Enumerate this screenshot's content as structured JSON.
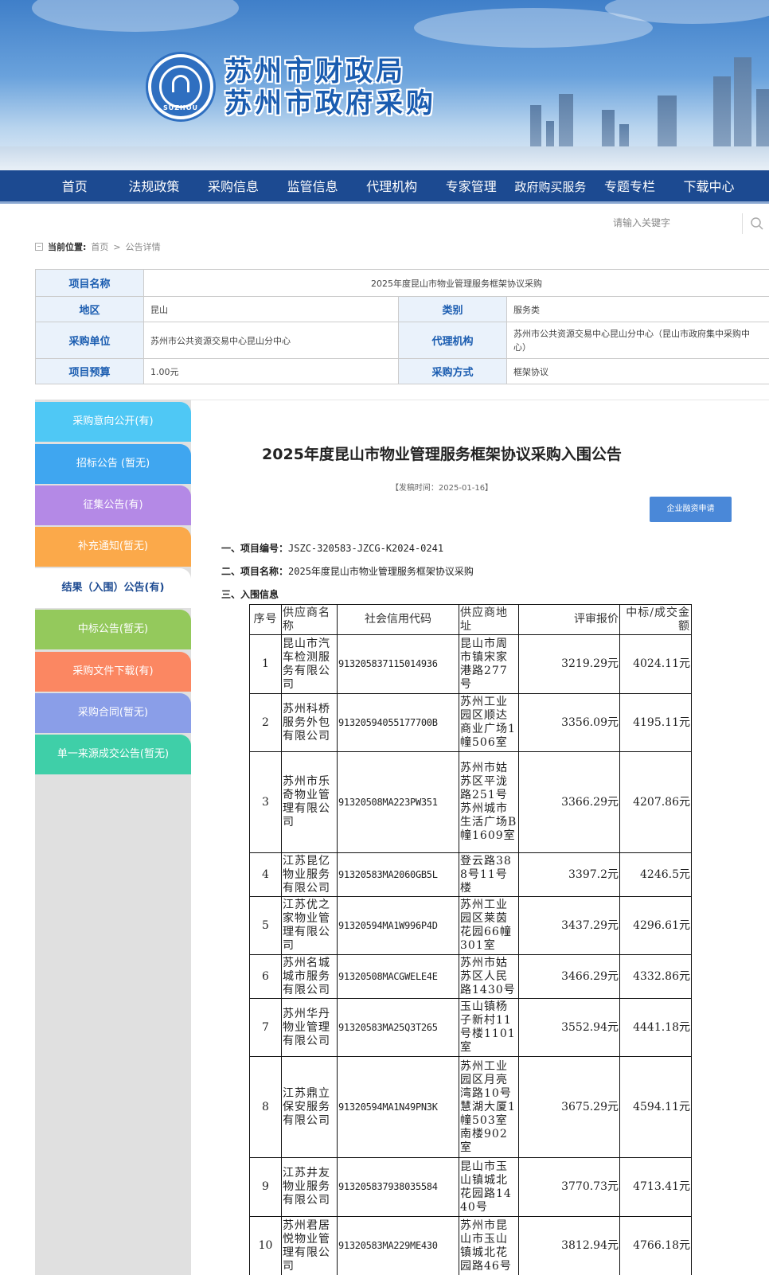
{
  "header": {
    "title_line1": "苏州市财政局",
    "title_line2": "苏州市政府采购",
    "seal_text": "SUZHOU"
  },
  "nav": [
    "首页",
    "法规政策",
    "采购信息",
    "监管信息",
    "代理机构",
    "专家管理",
    "政府购买服务",
    "专题专栏",
    "下载中心"
  ],
  "search": {
    "placeholder": "请输入关键字"
  },
  "breadcrumb": {
    "label": "当前位置:",
    "home": "首页",
    "sep": ">",
    "current": "公告详情"
  },
  "info": {
    "project_name_label": "项目名称",
    "project_name": "2025年度昆山市物业管理服务框架协议采购",
    "region_label": "地区",
    "region": "昆山",
    "category_label": "类别",
    "category": "服务类",
    "buyer_label": "采购单位",
    "buyer": "苏州市公共资源交易中心昆山分中心",
    "agency_label": "代理机构",
    "agency": "苏州市公共资源交易中心昆山分中心（昆山市政府集中采购中心）",
    "budget_label": "项目预算",
    "budget": "1.00元",
    "method_label": "采购方式",
    "method": "框架协议"
  },
  "sidebar": [
    {
      "label": "采购意向公开(有)",
      "color": "#4fc8f5"
    },
    {
      "label": "招标公告 (暂无)",
      "color": "#3fa6f0"
    },
    {
      "label": "征集公告(有)",
      "color": "#b489e6"
    },
    {
      "label": "补充通知(暂无)",
      "color": "#fba94a"
    },
    {
      "label": "结果（入围）公告(有)",
      "color": "#ffffff"
    },
    {
      "label": "中标公告(暂无)",
      "color": "#94c95c"
    },
    {
      "label": "采购文件下载(有)",
      "color": "#fb8762"
    },
    {
      "label": "采购合同(暂无)",
      "color": "#8a9ee8"
    },
    {
      "label": "单一来源成交公告(暂无)",
      "color": "#3fcfa8"
    }
  ],
  "notice": {
    "title": "2025年度昆山市物业管理服务框架协议采购入围公告",
    "pub_time": "【发稿时间：2025-01-16】",
    "finance_button": "企业融资申请",
    "sec1_label": "一、项目编号：",
    "sec1_value": "JSZC-320583-JZCG-K2024-0241",
    "sec2_label": "二、项目名称：",
    "sec2_value": "2025年度昆山市物业管理服务框架协议采购",
    "sec3_label": "三、入围信息"
  },
  "results": {
    "headers": [
      "序号",
      "供应商名称",
      "社会信用代码",
      "供应商地址",
      "评审报价",
      "中标/成交金额"
    ],
    "rows": [
      [
        "1",
        "昆山市汽车检测服务有限公司",
        "913205837115014936",
        "昆山市周市镇宋家港路277号",
        "3219.29元",
        "4024.11元"
      ],
      [
        "2",
        "苏州科桥服务外包有限公司",
        "91320594055177700B",
        "苏州工业园区顺达商业广场1幢506室",
        "3356.09元",
        "4195.11元"
      ],
      [
        "3",
        "苏州市乐奇物业管理有限公司",
        "91320508MA223PW351",
        "苏州市姑苏区平泷路251号苏州城市生活广场B幢1609室",
        "3366.29元",
        "4207.86元"
      ],
      [
        "4",
        "江苏昆亿物业服务有限公司",
        "91320583MA2060GB5L",
        "登云路388号11号楼",
        "3397.2元",
        "4246.5元"
      ],
      [
        "5",
        "江苏优之家物业管理有限公司",
        "91320594MA1W996P4D",
        "苏州工业园区莱茵花园66幢301室",
        "3437.29元",
        "4296.61元"
      ],
      [
        "6",
        "苏州名城城市服务有限公司",
        "91320508MACGWELE4E",
        "苏州市姑苏区人民路1430号",
        "3466.29元",
        "4332.86元"
      ],
      [
        "7",
        "苏州华丹物业管理有限公司",
        "91320583MA25Q3T265",
        "玉山镇杨子新村11号楼1101室",
        "3552.94元",
        "4441.18元"
      ],
      [
        "8",
        "江苏鼎立保安服务有限公司",
        "91320594MA1N49PN3K",
        "苏州工业园区月亮湾路10号慧湖大厦1幢503室南楼902室",
        "3675.29元",
        "4594.11元"
      ],
      [
        "9",
        "江苏井友物业服务有限公司",
        "913205837938035584",
        "昆山市玉山镇城北花园路1440号",
        "3770.73元",
        "4713.41元"
      ],
      [
        "10",
        "苏州君居悦物业管理有限公司",
        "91320583MA229ME430",
        "苏州市昆山市玉山镇城北花园路46号",
        "3812.94元",
        "4766.18元"
      ]
    ]
  }
}
